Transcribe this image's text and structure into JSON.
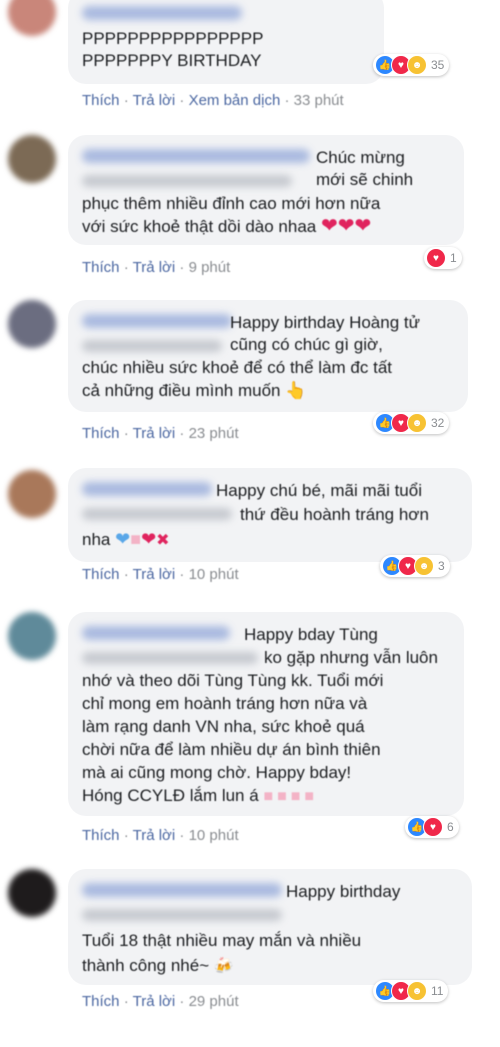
{
  "actions": {
    "like": "Thích",
    "reply": "Trả lời",
    "translate": "Xem bản dịch",
    "dot": "·"
  },
  "comments": [
    {
      "lines": [
        "PPPPPPPPPPPPPPPP",
        "PPPPPPPY BIRTHDAY"
      ],
      "reaction_count": "35",
      "time": "33 phút"
    },
    {
      "lines": [
        "Chúc mừng",
        "mới sẽ chinh",
        "phục thêm nhiều đỉnh cao mới hơn nữa",
        "với sức khoẻ thật dồi dào nhaa"
      ],
      "reaction_count": "1",
      "time": "9 phút"
    },
    {
      "lines": [
        "Happy birthday Hoàng tử",
        "cũng có chúc gì giờ,",
        "chúc nhiều sức khoẻ để có thể làm đc tất",
        "cả những điều mình muốn"
      ],
      "reaction_count": "32",
      "time": "23 phút"
    },
    {
      "lines": [
        "Happy chú bé, mãi mãi tuổi",
        "thứ đều hoành tráng hơn",
        "nha"
      ],
      "reaction_count": "3",
      "time": "10 phút"
    },
    {
      "lines": [
        "Happy bday Tùng",
        "ko gặp nhưng vẫn luôn",
        "nhớ và theo dõi Tùng Tùng kk. Tuổi mới",
        "chỉ mong em hoành tráng hơn nữa và",
        "làm rạng danh VN nha, sức khoẻ quá",
        "chời nữa để làm nhiều dự án bình thiên",
        "mà ai cũng mong chờ. Happy bday!",
        "Hóng CCYLĐ lắm lun á"
      ],
      "reaction_count": "6",
      "time": "10 phút"
    },
    {
      "lines": [
        "Happy birthday",
        "Tuổi 18 thật nhiều may mắn và nhiều",
        "thành công nhé~"
      ],
      "reaction_count": "11",
      "time": "29 phút"
    }
  ]
}
